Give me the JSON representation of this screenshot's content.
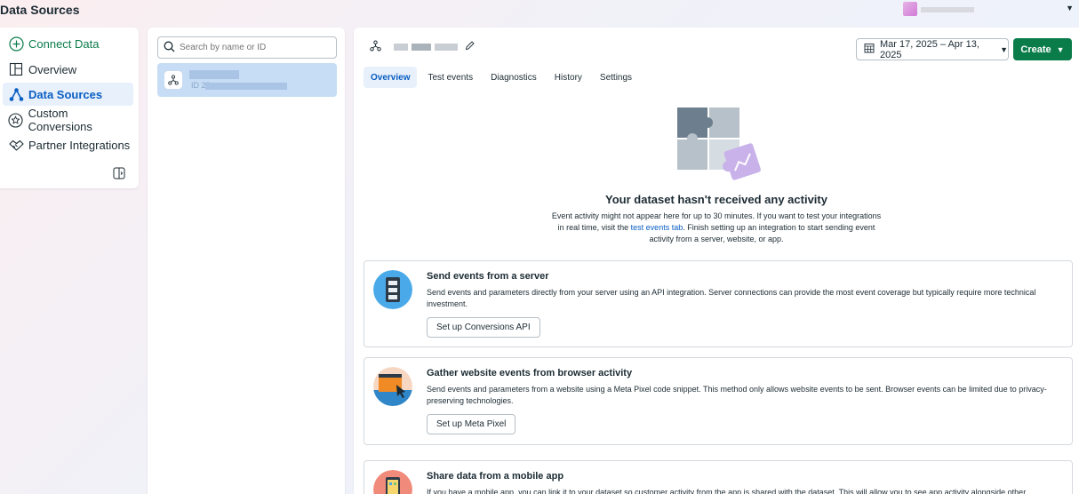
{
  "header": {
    "title": "Data Sources"
  },
  "nav": {
    "items": [
      {
        "label": "Connect Data",
        "icon": "plus-circle-icon"
      },
      {
        "label": "Overview",
        "icon": "layout-icon"
      },
      {
        "label": "Data Sources",
        "icon": "network-icon"
      },
      {
        "label": "Custom Conversions",
        "icon": "star-badge-icon"
      },
      {
        "label": "Partner Integrations",
        "icon": "handshake-icon"
      }
    ]
  },
  "search": {
    "placeholder": "Search by name or ID"
  },
  "source_list": {
    "selected_id_prefix": "ID 29"
  },
  "toolbar": {
    "date_range": "Mar 17, 2025 – Apr 13, 2025",
    "create_label": "Create"
  },
  "tabs": [
    "Overview",
    "Test events",
    "Diagnostics",
    "History",
    "Settings"
  ],
  "empty_state": {
    "title": "Your dataset hasn't received any activity",
    "desc_before": "Event activity might not appear here for up to 30 minutes. If you want to test your integrations in real time, visit the ",
    "link": "test events tab",
    "desc_after": ". Finish setting up an integration to start sending event activity from a server, website, or app."
  },
  "cards": [
    {
      "title": "Send events from a server",
      "desc": "Send events and parameters directly from your server using an API integration. Server connections can provide the most event coverage but typically require more technical investment.",
      "button": "Set up Conversions API"
    },
    {
      "title": "Gather website events from browser activity",
      "desc": "Send events and parameters from a website using a Meta Pixel code snippet. This method only allows website events to be sent. Browser events can be limited due to privacy-preserving technologies.",
      "button": "Set up Meta Pixel"
    },
    {
      "title": "Share data from a mobile app",
      "desc": "If you have a mobile app, you can link it to your dataset so customer activity from the app is shared with the dataset. This will allow you to see app activity alongside other"
    }
  ],
  "colors": {
    "accent_green": "#0a7c4a",
    "accent_blue": "#0a5ec2",
    "active_bg": "#e7f0fb"
  }
}
